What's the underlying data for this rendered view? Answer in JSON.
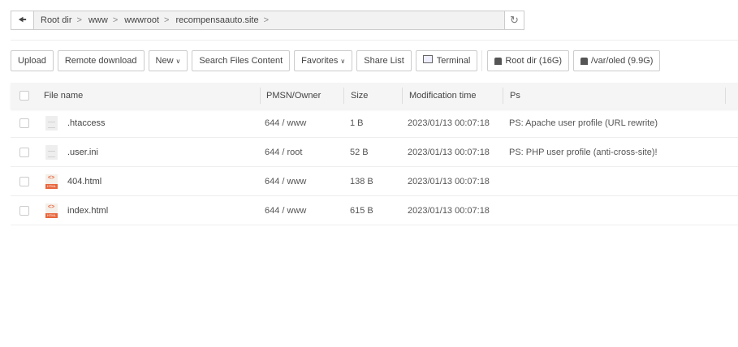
{
  "breadcrumb": {
    "items": [
      "Root dir",
      "www",
      "wwwroot",
      "recompensaauto.site"
    ],
    "separator": ">"
  },
  "toolbar": {
    "upload": "Upload",
    "remote_download": "Remote download",
    "new": "New",
    "search": "Search Files Content",
    "favorites": "Favorites",
    "share_list": "Share List",
    "terminal": "Terminal",
    "disks": [
      "Root dir (16G)",
      "/var/oled (9.9G)"
    ]
  },
  "table": {
    "headers": {
      "name": "File name",
      "perm": "PMSN/Owner",
      "size": "Size",
      "mtime": "Modification time",
      "ps": "Ps"
    },
    "rows": [
      {
        "name": ".htaccess",
        "type": "text",
        "perm": "644 / www",
        "size": "1 B",
        "mtime": "2023/01/13 00:07:18",
        "ps": "PS: Apache user profile (URL rewrite)"
      },
      {
        "name": ".user.ini",
        "type": "text",
        "perm": "644 / root",
        "size": "52 B",
        "mtime": "2023/01/13 00:07:18",
        "ps": "PS: PHP user profile (anti-cross-site)!"
      },
      {
        "name": "404.html",
        "type": "html",
        "perm": "644 / www",
        "size": "138 B",
        "mtime": "2023/01/13 00:07:18",
        "ps": ""
      },
      {
        "name": "index.html",
        "type": "html",
        "perm": "644 / www",
        "size": "615 B",
        "mtime": "2023/01/13 00:07:18",
        "ps": ""
      }
    ]
  },
  "icons": {
    "html_tag": "HTML",
    "html_code": "<>"
  }
}
